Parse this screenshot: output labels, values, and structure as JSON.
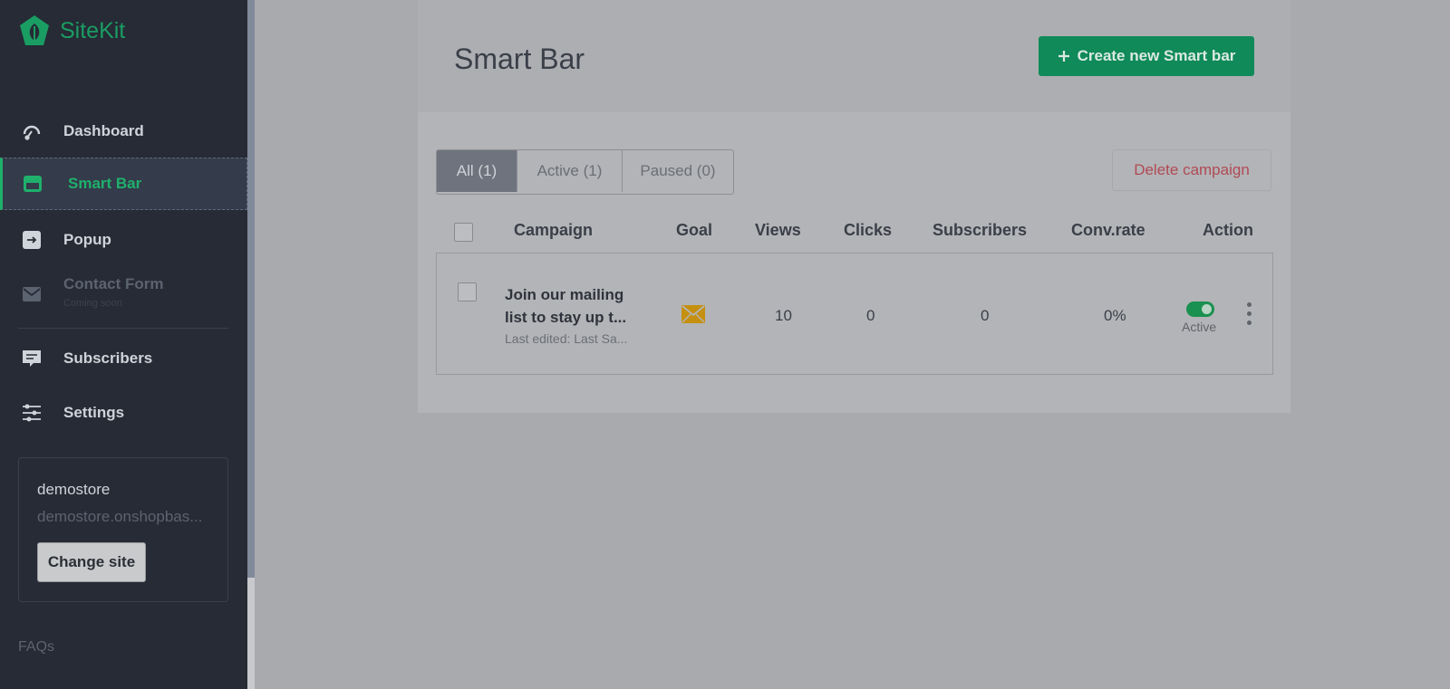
{
  "app": {
    "name": "SiteKit",
    "brand_color": "#1a9d63"
  },
  "sidebar": {
    "items": [
      {
        "label": "Dashboard",
        "icon": "dashboard-gauge-icon"
      },
      {
        "label": "Smart Bar",
        "icon": "smart-bar-icon",
        "active": true
      },
      {
        "label": "Popup",
        "icon": "popup-icon"
      },
      {
        "label": "Contact Form",
        "sub": "Coming soon",
        "icon": "envelope-icon",
        "disabled": true
      },
      {
        "label": "Subscribers",
        "icon": "subscribers-chat-icon"
      },
      {
        "label": "Settings",
        "icon": "settings-sliders-icon"
      }
    ],
    "site": {
      "name": "demostore",
      "url": "demostore.onshopbas...",
      "change_label": "Change site"
    },
    "faqs_label": "FAQs"
  },
  "header": {
    "title": "Smart Bar",
    "create_label": "Create new Smart bar"
  },
  "filters": {
    "tabs": [
      {
        "label": "All (1)",
        "selected": true
      },
      {
        "label": "Active (1)"
      },
      {
        "label": "Paused (0)"
      }
    ],
    "delete_label": "Delete campaign"
  },
  "table": {
    "headers": [
      "Campaign",
      "Goal",
      "Views",
      "Clicks",
      "Subscribers",
      "Conv.rate",
      "Action"
    ],
    "rows": [
      {
        "title": "Join our mailing list to stay up t...",
        "subtitle": "Last edited: Last Sa...",
        "goal_icon": "envelope-icon",
        "views": "10",
        "clicks": "0",
        "subscribers": "0",
        "conv_rate": "0%",
        "status": "Active"
      }
    ]
  }
}
